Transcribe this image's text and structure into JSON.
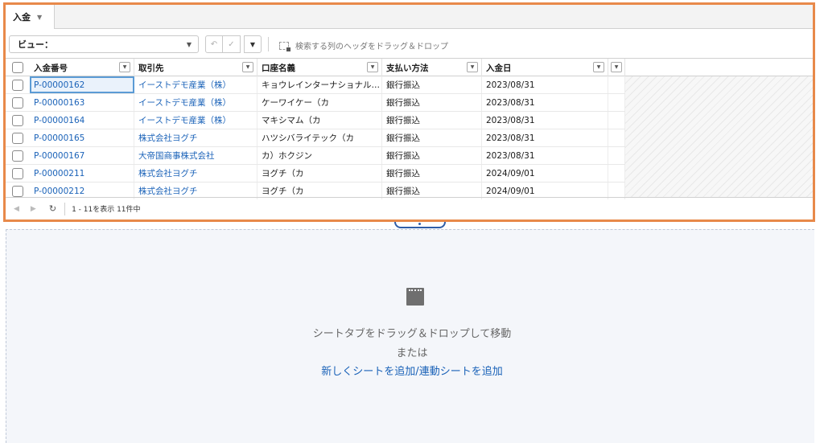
{
  "tab": {
    "label": "入金"
  },
  "toolbar": {
    "view_label": "ビュー：",
    "group_hint": "検索する列のヘッダをドラッグ＆ドロップ"
  },
  "columns": [
    "入金番号",
    "取引先",
    "口座名義",
    "支払い方法",
    "入金日"
  ],
  "rows": [
    {
      "no": "P-00000162",
      "account": "イーストデモ産業（株）",
      "holder": "キョウレインターナショナル…",
      "method": "銀行振込",
      "date": "2023/08/31"
    },
    {
      "no": "P-00000163",
      "account": "イーストデモ産業（株）",
      "holder": "ケーワイケー（カ",
      "method": "銀行振込",
      "date": "2023/08/31"
    },
    {
      "no": "P-00000164",
      "account": "イーストデモ産業（株）",
      "holder": "マキシマム（カ",
      "method": "銀行振込",
      "date": "2023/08/31"
    },
    {
      "no": "P-00000165",
      "account": "株式会社ヨグチ",
      "holder": "ハツシバライテック（カ",
      "method": "銀行振込",
      "date": "2023/08/31"
    },
    {
      "no": "P-00000167",
      "account": "大帝国商事株式会社",
      "holder": "カ）ホクジン",
      "method": "銀行振込",
      "date": "2023/08/31"
    },
    {
      "no": "P-00000211",
      "account": "株式会社ヨグチ",
      "holder": "ヨグチ（カ",
      "method": "銀行振込",
      "date": "2024/09/01"
    },
    {
      "no": "P-00000212",
      "account": "株式会社ヨグチ",
      "holder": "ヨグチ（カ",
      "method": "銀行振込",
      "date": "2024/09/01"
    }
  ],
  "status": {
    "count_text": "1 - 11を表示 11件中"
  },
  "dropzone": {
    "line1": "シートタブをドラッグ＆ドロップして移動",
    "line2": "または",
    "link_add_sheet": "新しくシートを追加",
    "separator": "/",
    "link_add_linked": "連動シートを追加"
  },
  "icons": {
    "tab_caret": "chevron-down-icon",
    "view_dropdown": "chevron-down-icon",
    "undo": "undo-icon",
    "check": "check-icon",
    "group": "group-by-icon",
    "filter": "filter-dropdown-icon",
    "prev": "prev-page-icon",
    "next": "next-page-icon",
    "refresh": "refresh-icon",
    "sheet": "sheet-icon"
  },
  "colors": {
    "frame": "#e8894a",
    "link": "#1a62b8",
    "selection": "#5b9bd5"
  }
}
